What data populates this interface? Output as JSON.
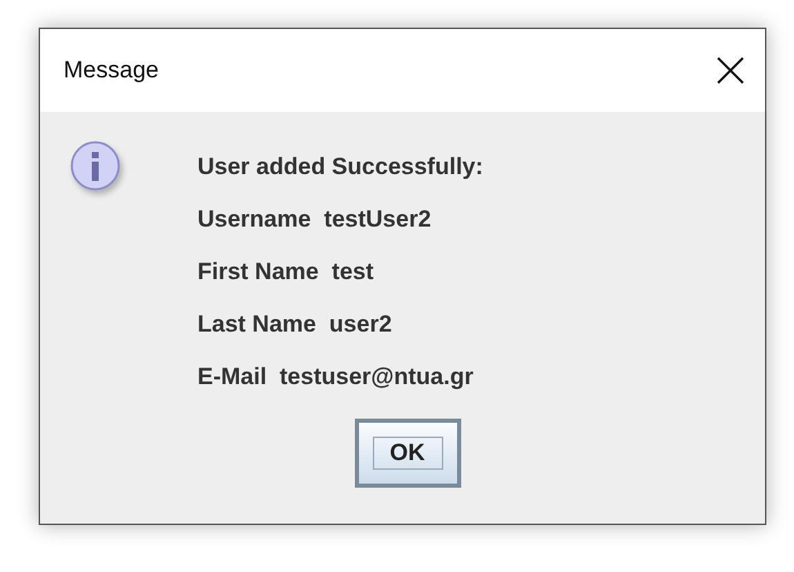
{
  "window": {
    "title": "Message"
  },
  "message_lines": [
    "User added Successfully:",
    "Username  testUser2",
    "First Name  test",
    "Last Name  user2",
    "E-Mail  testuser@ntua.gr"
  ],
  "buttons": [
    {
      "label": "OK",
      "focused": true
    }
  ]
}
